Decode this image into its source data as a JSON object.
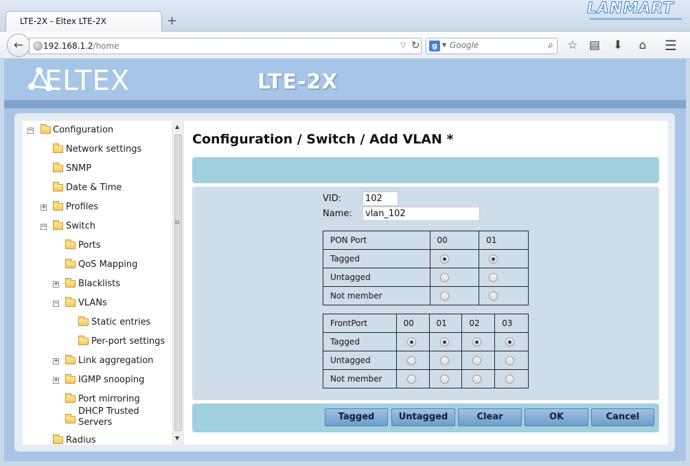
{
  "browser": {
    "tab_title": "LTE-2X - Eltex LTE-2X",
    "new_tab": "+",
    "url_host": "192.168.1.2",
    "url_path": "/home",
    "search_placeholder": "Google",
    "search_engine": "g",
    "watermark": "LANMART"
  },
  "header": {
    "logo": "ELTEX",
    "model": "LTE-2X"
  },
  "sidebar": {
    "items": [
      {
        "label": "Configuration",
        "toggle": "−"
      },
      {
        "label": "Network settings",
        "toggle": ""
      },
      {
        "label": "SNMP",
        "toggle": ""
      },
      {
        "label": "Date & Time",
        "toggle": ""
      },
      {
        "label": "Profiles",
        "toggle": "+"
      },
      {
        "label": "Switch",
        "toggle": "−"
      },
      {
        "label": "Ports",
        "toggle": ""
      },
      {
        "label": "QoS Mapping",
        "toggle": ""
      },
      {
        "label": "Blacklists",
        "toggle": "+"
      },
      {
        "label": "VLANs",
        "toggle": "−"
      },
      {
        "label": "Static entries",
        "toggle": ""
      },
      {
        "label": "Per-port settings",
        "toggle": ""
      },
      {
        "label": "Link aggregation",
        "toggle": "+"
      },
      {
        "label": "IGMP snooping",
        "toggle": "+"
      },
      {
        "label": "Port mirroring",
        "toggle": ""
      },
      {
        "label": "DHCP Trusted",
        "label2": "Servers",
        "toggle": ""
      },
      {
        "label": "Radius",
        "toggle": ""
      }
    ]
  },
  "main": {
    "title": "Configuration / Switch / Add VLAN *",
    "vid_label": "VID:",
    "vid_value": "102",
    "name_label": "Name:",
    "name_value": "vlan_102",
    "pon_table": {
      "header": [
        "PON Port",
        "00",
        "01"
      ],
      "rows": [
        {
          "label": "Tagged",
          "selected": [
            true,
            true
          ]
        },
        {
          "label": "Untagged",
          "selected": [
            false,
            false
          ]
        },
        {
          "label": "Not member",
          "selected": [
            false,
            false
          ]
        }
      ]
    },
    "front_table": {
      "header": [
        "FrontPort",
        "00",
        "01",
        "02",
        "03"
      ],
      "rows": [
        {
          "label": "Tagged",
          "selected": [
            true,
            true,
            true,
            true
          ]
        },
        {
          "label": "Untagged",
          "selected": [
            false,
            false,
            false,
            false
          ]
        },
        {
          "label": "Not member",
          "selected": [
            false,
            false,
            false,
            false
          ]
        }
      ]
    },
    "buttons": {
      "tagged": "Tagged",
      "untagged": "Untagged",
      "clear": "Clear",
      "ok": "OK",
      "cancel": "Cancel"
    }
  }
}
